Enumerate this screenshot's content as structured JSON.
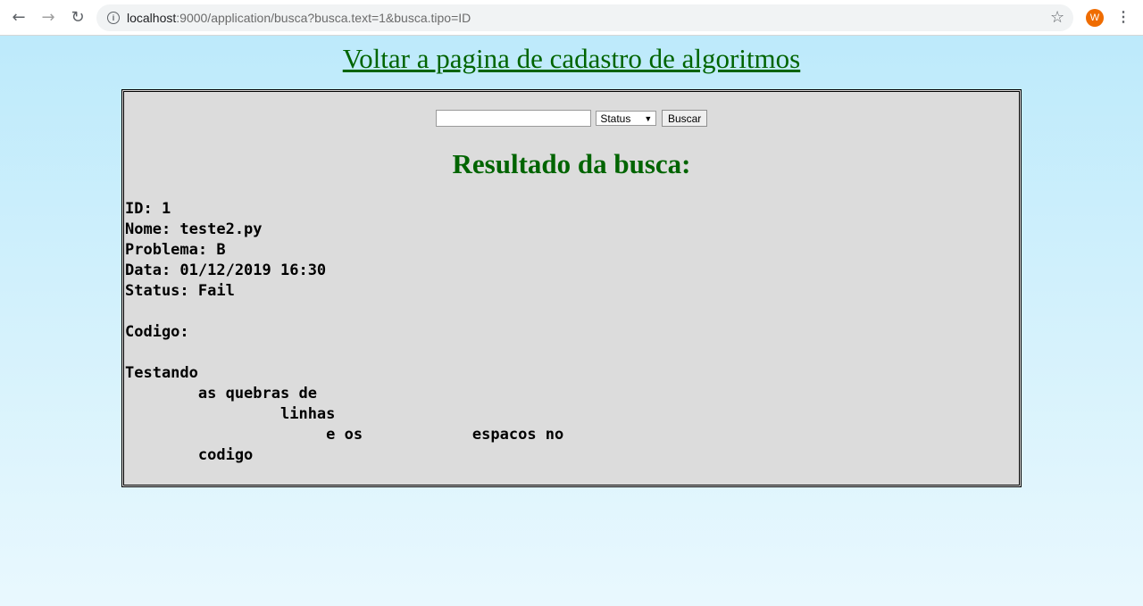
{
  "browser": {
    "url_host": "localhost",
    "url_rest": ":9000/application/busca?busca.text=1&busca.tipo=ID",
    "avatar_letter": "W"
  },
  "page": {
    "back_link": "Voltar a pagina de cadastro de algoritmos",
    "search": {
      "input_value": "",
      "select_value": "Status",
      "button_label": "Buscar"
    },
    "results_title": "Resultado da busca:",
    "result": {
      "id_line": "ID: 1",
      "nome_line": "Nome: teste2.py",
      "problema_line": "Problema: B",
      "data_line": "Data: 01/12/2019 16:30",
      "status_line": "Status: Fail",
      "codigo_label": "Codigo:",
      "code_lines": [
        "Testando",
        "        as quebras de",
        "                 linhas",
        "                      e os            espacos no",
        "        codigo"
      ]
    }
  },
  "colors": {
    "link_green": "#006400",
    "panel_bg": "#dcdcdc",
    "page_bg_top": "#bdeafb",
    "avatar": "#ef6c00"
  }
}
